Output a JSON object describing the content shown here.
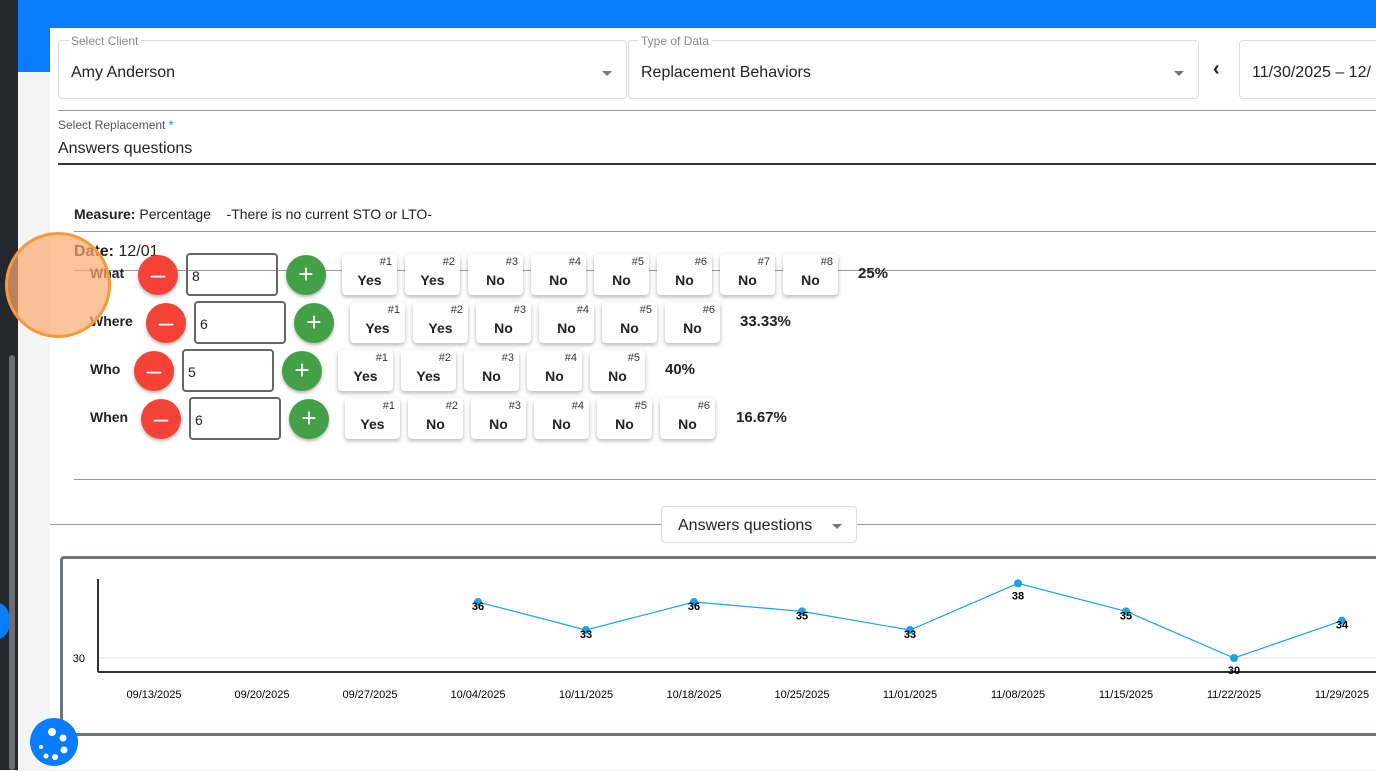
{
  "filters": {
    "client_label": "Select Client",
    "client_value": "Amy Anderson",
    "type_label": "Type of Data",
    "type_value": "Replacement Behaviors",
    "date_range": "11/30/2025 – 12/",
    "replacement_label": "Select Replacement",
    "required_mark": "*",
    "replacement_value": "Answers questions"
  },
  "measure": {
    "label": "Measure:",
    "value": "Percentage",
    "note": "-There is no current STO or LTO-"
  },
  "date": {
    "label": "Date:",
    "value": "12/01"
  },
  "rows": [
    {
      "label": "What",
      "count": "8",
      "trials": [
        "Yes",
        "Yes",
        "No",
        "No",
        "No",
        "No",
        "No",
        "No"
      ],
      "percent": "25%"
    },
    {
      "label": "Where",
      "count": "6",
      "trials": [
        "Yes",
        "Yes",
        "No",
        "No",
        "No",
        "No"
      ],
      "percent": "33.33%"
    },
    {
      "label": "Who",
      "count": "5",
      "trials": [
        "Yes",
        "Yes",
        "No",
        "No",
        "No"
      ],
      "percent": "40%"
    },
    {
      "label": "When",
      "count": "6",
      "trials": [
        "Yes",
        "No",
        "No",
        "No",
        "No",
        "No"
      ],
      "percent": "16.67%"
    }
  ],
  "chart_select": "Answers questions",
  "colors": {
    "primary": "#0a7cff",
    "minus": "#f44336",
    "plus": "#43a047",
    "series": "#1aa3e8"
  },
  "chart_data": {
    "type": "line",
    "categories": [
      "09/13/2025",
      "09/20/2025",
      "09/27/2025",
      "10/04/2025",
      "10/11/2025",
      "10/18/2025",
      "10/25/2025",
      "11/01/2025",
      "11/08/2025",
      "11/15/2025",
      "11/22/2025",
      "11/29/2025"
    ],
    "values": [
      null,
      null,
      null,
      36,
      33,
      36,
      35,
      33,
      38,
      35,
      30,
      34
    ],
    "yticks": [
      30
    ],
    "ylim": [
      28.5,
      39.5
    ],
    "grid": true
  }
}
